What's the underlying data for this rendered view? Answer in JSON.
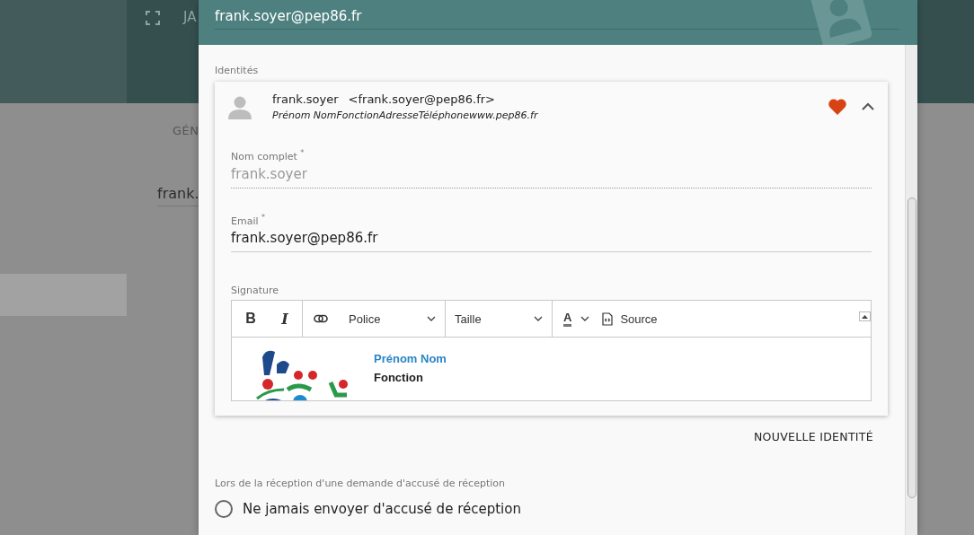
{
  "background": {
    "header_text": "JA",
    "tab": "GÉN",
    "field_value": "frank."
  },
  "dialog": {
    "email": "frank.soyer@pep86.fr",
    "identities_label": "Identités",
    "identity": {
      "name": "frank.soyer",
      "address": "<frank.soyer@pep86.fr>",
      "summary": "Prénom NomFonctionAdresseTéléphonewww.pep86.fr",
      "favorite": true,
      "expanded": true,
      "fields": [
        {
          "label": "Nom complet $^{*}$",
          "value": "frank.soyer",
          "disabled": true
        },
        {
          "label": "Email $^{*}$",
          "value": "frank.soyer@pep86.fr",
          "disabled": false
        }
      ],
      "signature": {
        "label": "Signature",
        "toolbar": [
          {
            "kind": "bold",
            "label": "B"
          },
          {
            "kind": "italic",
            "label": "I"
          },
          {
            "kind": "link"
          },
          {
            "kind": "select",
            "label": "Police"
          },
          {
            "kind": "select",
            "label": "Taille"
          },
          {
            "kind": "color",
            "label": "A"
          },
          {
            "kind": "source",
            "label": "Source"
          }
        ],
        "content": {
          "name": "Prénom Nom",
          "role": "Fonction"
        }
      }
    },
    "new_identity_button": "NOUVELLE IDENTITÉ",
    "receipt": {
      "label": "Lors de la réception d'une demande d'accusé de réception",
      "options": [
        {
          "label": "Ne jamais envoyer d'accusé de réception",
          "selected": false
        }
      ]
    }
  }
}
